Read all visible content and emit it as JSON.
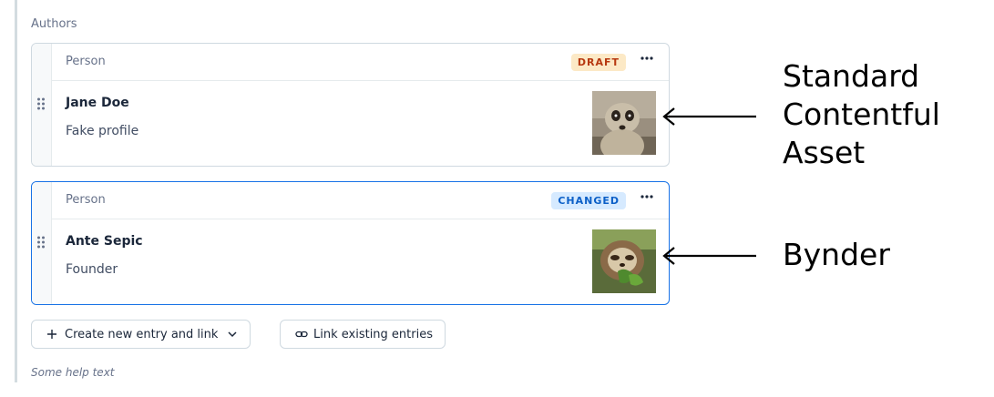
{
  "field": {
    "label": "Authors",
    "help_text": "Some help text"
  },
  "entries": [
    {
      "content_type": "Person",
      "status": "DRAFT",
      "title": "Jane Doe",
      "description": "Fake profile",
      "thumbnail": "meerkat-photo",
      "more_icon": "ellipsis-icon"
    },
    {
      "content_type": "Person",
      "status": "CHANGED",
      "title": "Ante Sepic",
      "description": "Founder",
      "thumbnail": "sloth-photo",
      "more_icon": "ellipsis-icon"
    }
  ],
  "actions": {
    "create_label": "Create new entry and link",
    "link_label": "Link existing entries"
  },
  "annotations": {
    "first_line1": "Standard",
    "first_line2": "Contentful",
    "first_line3": "Asset",
    "second": "Bynder"
  },
  "colors": {
    "active_border": "#1872e6",
    "draft_bg": "#fce9c6",
    "draft_text": "#b7380f",
    "changed_bg": "#d6eaff",
    "changed_text": "#0b5fc7"
  }
}
